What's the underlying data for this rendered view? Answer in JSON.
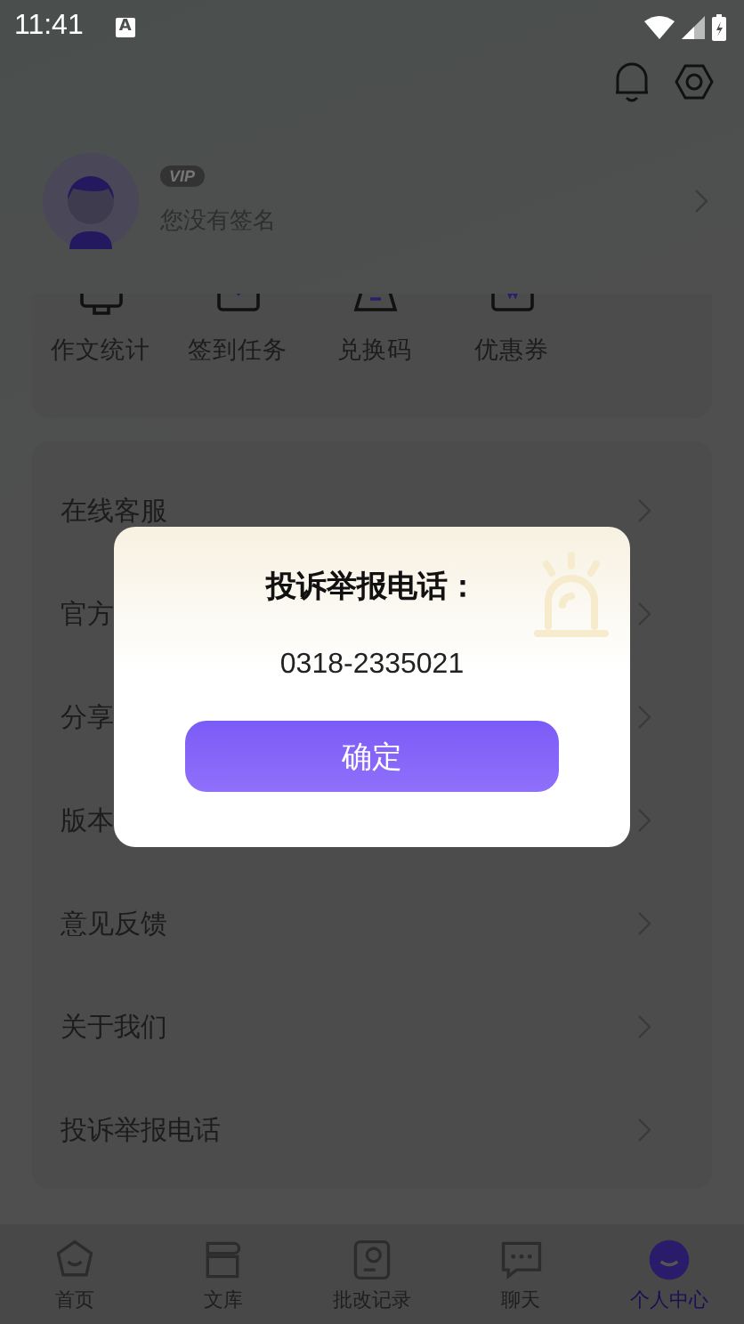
{
  "status_bar": {
    "time": "11:41",
    "notification": "A"
  },
  "profile": {
    "badge": "VIP",
    "signature": "您没有签名"
  },
  "shortcuts": [
    {
      "label": "作文统计"
    },
    {
      "label": "签到任务"
    },
    {
      "label": "兑换码"
    },
    {
      "label": "优惠券"
    }
  ],
  "menu": [
    {
      "label": "在线客服"
    },
    {
      "label": "官方"
    },
    {
      "label": "分享"
    },
    {
      "label": "版本"
    },
    {
      "label": "意见反馈"
    },
    {
      "label": "关于我们"
    },
    {
      "label": "投诉举报电话"
    }
  ],
  "dialog": {
    "title": "投诉举报电话：",
    "phone": "0318-2335021",
    "button": "确定"
  },
  "tabs": [
    {
      "label": "首页",
      "selected": false
    },
    {
      "label": "文库",
      "selected": false
    },
    {
      "label": "批改记录",
      "selected": false
    },
    {
      "label": "聊天",
      "selected": false
    },
    {
      "label": "个人中心",
      "selected": true
    }
  ]
}
